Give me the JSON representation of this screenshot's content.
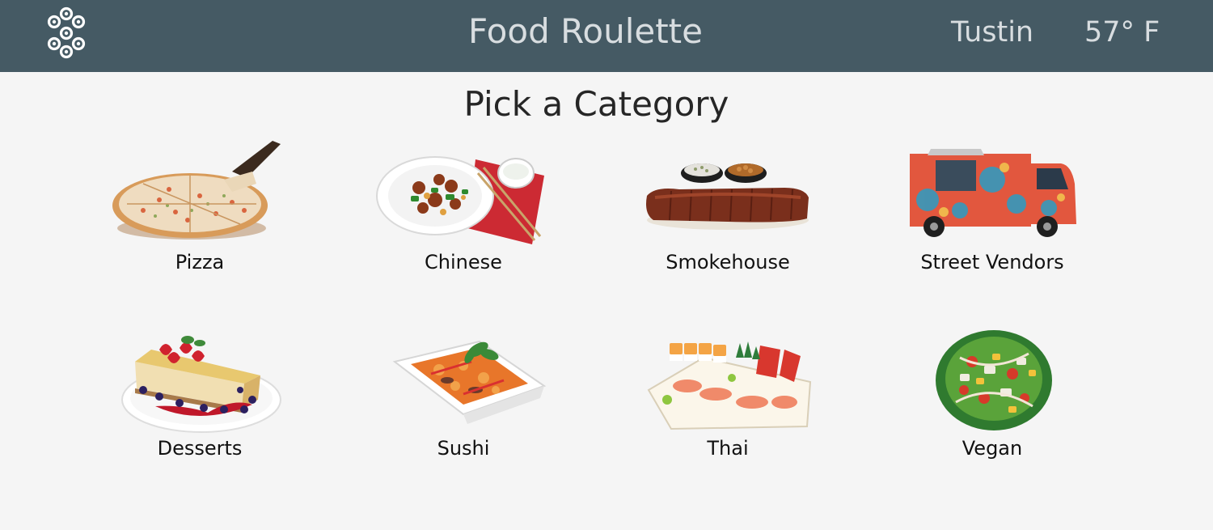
{
  "header": {
    "title": "Food Roulette",
    "city": "Tustin",
    "temperature": "57° F",
    "logo_icon": "dice-dots-logo-icon",
    "background_color": "#455a64"
  },
  "main": {
    "heading": "Pick a Category",
    "categories": [
      {
        "label": "Pizza",
        "icon": "pizza-icon"
      },
      {
        "label": "Chinese",
        "icon": "chinese-dish-icon"
      },
      {
        "label": "Smokehouse",
        "icon": "ribs-icon"
      },
      {
        "label": "Street Vendors",
        "icon": "food-truck-icon"
      },
      {
        "label": "Desserts",
        "icon": "cheesecake-icon"
      },
      {
        "label": "Sushi",
        "icon": "curry-bowl-icon"
      },
      {
        "label": "Thai",
        "icon": "sushi-platter-icon"
      },
      {
        "label": "Vegan",
        "icon": "salad-icon"
      }
    ]
  }
}
